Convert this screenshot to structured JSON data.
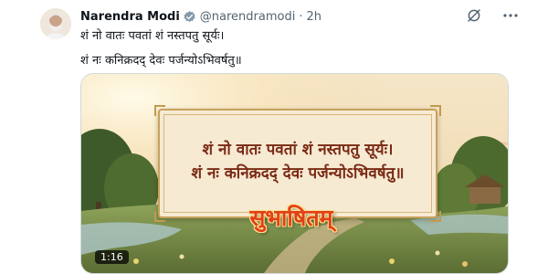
{
  "post": {
    "author_name": "Narendra Modi",
    "author_handle": "@narendramodi",
    "separator": "·",
    "timestamp": "2h",
    "verified": true,
    "text_line_1": "शं नो वातः पवतां शं नस्तपतु सूर्यः।",
    "text_line_2": "शं नः कनिक्रदद् देवः पर्जन्योऽभिवर्षतु॥"
  },
  "header_icons": [
    "verified-badge-icon",
    "grok-icon",
    "more-icon"
  ],
  "media": {
    "type": "video",
    "duration": "1:16",
    "verse_line_1": "शं नो वातः पवतां शं नस्तपतु सूर्यः।",
    "verse_line_2": "शं नः कनिक्रदद् देवः पर्जन्योऽभिवर्षतु॥",
    "title_text": "सुभाषितम्"
  },
  "colors": {
    "name": "#0f1419",
    "secondary_text": "#536471",
    "verified": "#829aab",
    "verse": "#7a2a14",
    "title_accent": "#e0401a"
  }
}
